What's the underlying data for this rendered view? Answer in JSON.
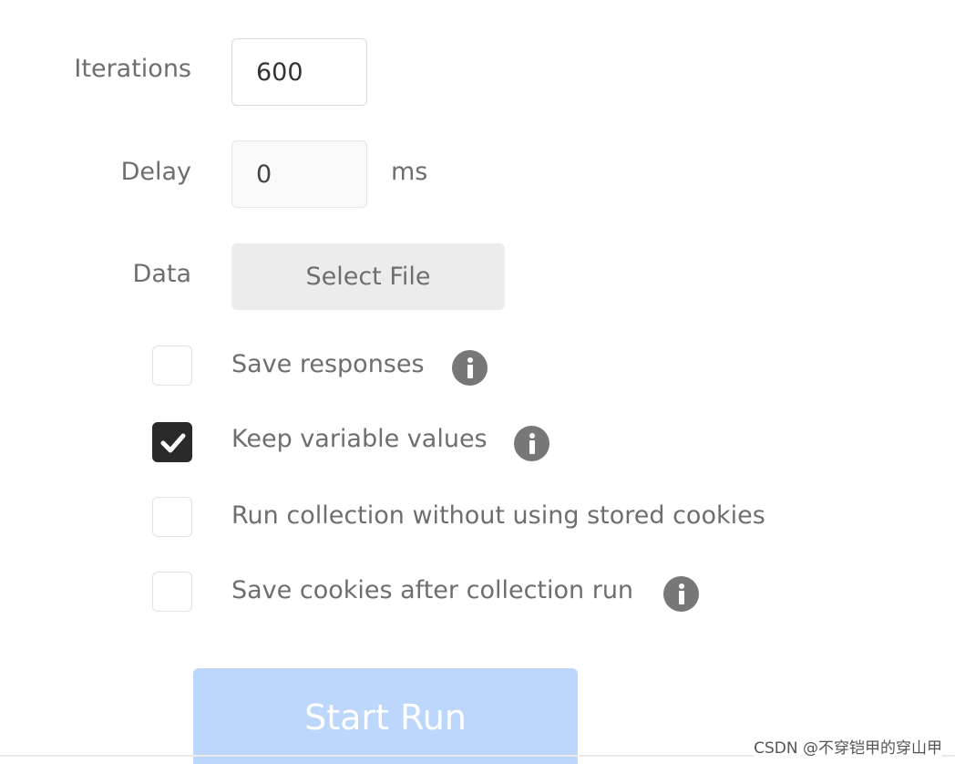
{
  "settings": {
    "iterations": {
      "label": "Iterations",
      "value": "600"
    },
    "delay": {
      "label": "Delay",
      "value": "0",
      "unit": "ms"
    },
    "data": {
      "label": "Data",
      "button_label": "Select File"
    }
  },
  "options": [
    {
      "label": "Save responses",
      "checked": false,
      "has_info": true
    },
    {
      "label": "Keep variable values",
      "checked": true,
      "has_info": true
    },
    {
      "label": "Run collection without using stored cookies",
      "checked": false,
      "has_info": false
    },
    {
      "label": "Save cookies after collection run",
      "checked": false,
      "has_info": true
    }
  ],
  "actions": {
    "start_run_label": "Start Run"
  },
  "watermark": "CSDN @不穿铠甲的穿山甲",
  "colors": {
    "start_button": "#bcd7fb",
    "checkbox_checked": "#2a2a2a",
    "info_icon": "#777777"
  },
  "icons": {
    "info": "info-circle-icon",
    "check": "checkmark-icon"
  }
}
